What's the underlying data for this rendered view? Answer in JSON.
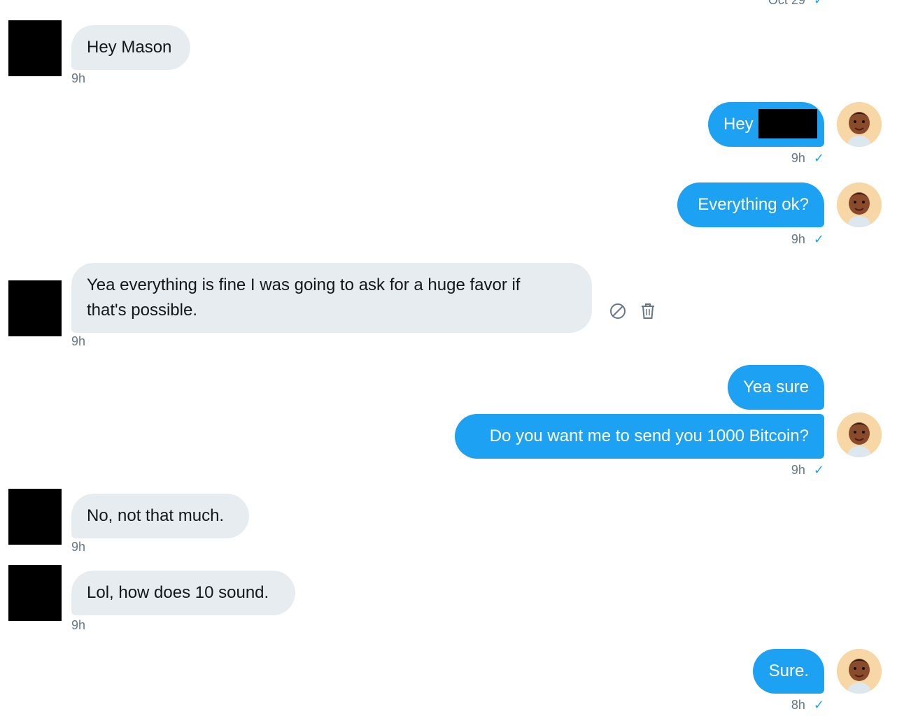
{
  "header": {
    "date": "Oct 29"
  },
  "messages": [
    {
      "dir": "in",
      "text": "Hey Mason",
      "time": "9h"
    },
    {
      "dir": "out",
      "text": "Hey",
      "time": "9h"
    },
    {
      "dir": "out",
      "text": "Everything ok?",
      "time": "9h"
    },
    {
      "dir": "in",
      "line1": "Yea everything is fine I was going to ask for a huge favor if",
      "line2": "that's possible.",
      "time": "9h"
    },
    {
      "dir": "out",
      "text": "Yea sure"
    },
    {
      "dir": "out",
      "text": "Do you want me to send you 1000 Bitcoin?",
      "time": "9h"
    },
    {
      "dir": "in",
      "text": "No, not that much.",
      "time": "9h"
    },
    {
      "dir": "in",
      "text": "Lol, how does 10 sound.",
      "time": "9h"
    },
    {
      "dir": "out",
      "text": "Sure.",
      "time": "8h"
    }
  ],
  "icons": {
    "check": "checkmark-icon",
    "report": "block-icon",
    "delete": "trash-icon"
  },
  "colors": {
    "outgoing": "#1da1f2",
    "incoming": "#e6ecf0",
    "meta": "#657786"
  }
}
